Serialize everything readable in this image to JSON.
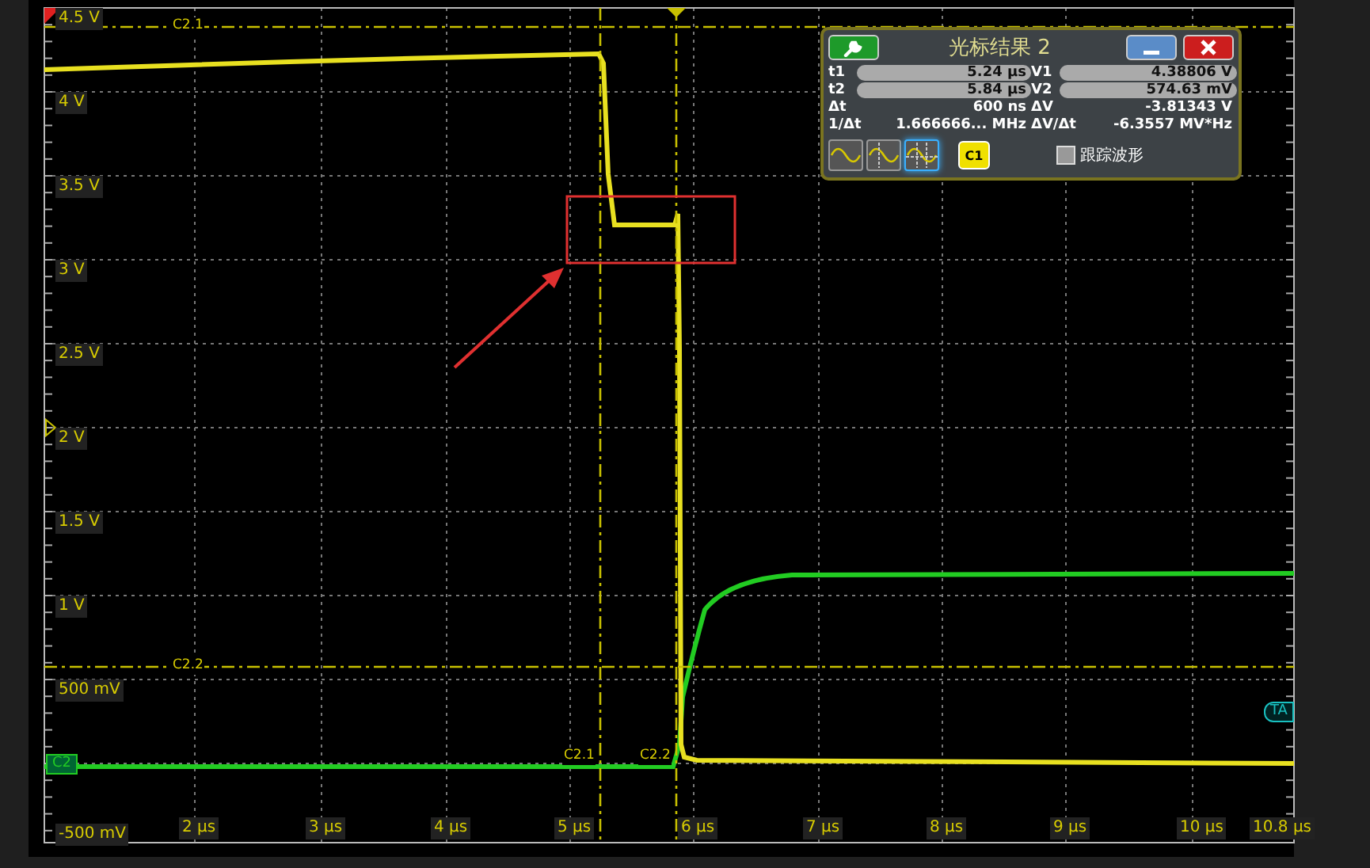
{
  "y_axis": {
    "labels": [
      "4.5 V",
      "4 V",
      "3.5 V",
      "3 V",
      "2.5 V",
      "2 V",
      "1.5 V",
      "1 V",
      "500 mV",
      "-500 mV"
    ]
  },
  "x_axis": {
    "labels": [
      "2 µs",
      "3 µs",
      "4 µs",
      "5 µs",
      "6 µs",
      "7 µs",
      "8 µs",
      "9 µs",
      "10 µs",
      "10.8 µs"
    ]
  },
  "cursors": [
    {
      "label": "C2.1",
      "kind": "horizontal"
    },
    {
      "label": "C2.2",
      "kind": "horizontal"
    },
    {
      "label": "C2.1",
      "kind": "vertical"
    },
    {
      "label": "C2.2",
      "kind": "vertical"
    }
  ],
  "channel_tags": [
    {
      "label": "C2",
      "kind": "channel"
    },
    {
      "label": "TA",
      "kind": "reference"
    }
  ],
  "cursor_panel": {
    "title": "光标结果 2",
    "rows": [
      {
        "label": "t1",
        "value": "5.24 µs",
        "kind": "field"
      },
      {
        "label": "V1",
        "value": "4.38806 V",
        "kind": "field"
      },
      {
        "label": "t2",
        "value": "5.84 µs",
        "kind": "field"
      },
      {
        "label": "V2",
        "value": "574.63 mV",
        "kind": "field"
      },
      {
        "label": "Δt",
        "value": "600 ns",
        "kind": "text"
      },
      {
        "label": "ΔV",
        "value": "-3.81343 V",
        "kind": "text"
      },
      {
        "label": "1/Δt",
        "value": "1.666666... MHz",
        "kind": "text"
      },
      {
        "label": "ΔV/Δt",
        "value": "-6.3557 MV*Hz",
        "kind": "text"
      }
    ],
    "modes": [
      {
        "selected": false
      },
      {
        "selected": false
      },
      {
        "selected": true
      }
    ],
    "source_button": "C1",
    "track_waveform": {
      "label": "跟踪波形",
      "checked": false
    }
  }
}
